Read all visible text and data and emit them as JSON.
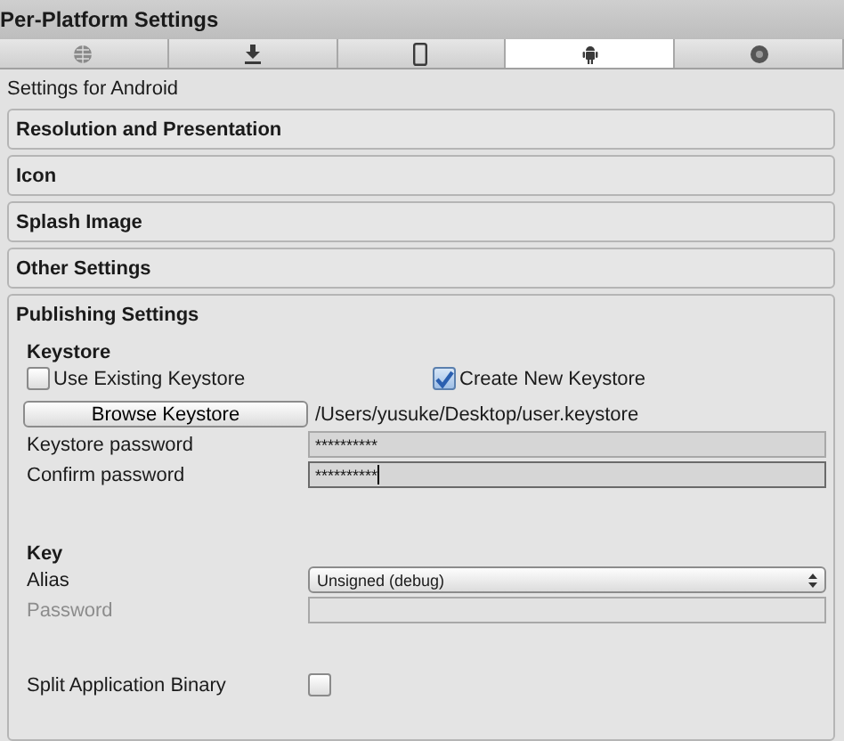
{
  "panel": {
    "title": "Per-Platform Settings"
  },
  "tabs": [
    {
      "kind": "globe",
      "selected": false
    },
    {
      "kind": "download",
      "selected": false
    },
    {
      "kind": "phone",
      "selected": false
    },
    {
      "kind": "android",
      "selected": true
    },
    {
      "kind": "disc",
      "selected": false
    }
  ],
  "subtitle": "Settings for Android",
  "sections": [
    {
      "title": "Resolution and Presentation",
      "expanded": false
    },
    {
      "title": "Icon",
      "expanded": false
    },
    {
      "title": "Splash Image",
      "expanded": false
    },
    {
      "title": "Other Settings",
      "expanded": false
    }
  ],
  "publishing": {
    "title": "Publishing Settings",
    "keystore": {
      "heading": "Keystore",
      "options": [
        {
          "label": "Use Existing Keystore",
          "checked": false
        },
        {
          "label": "Create New Keystore",
          "checked": true
        }
      ],
      "browse_button": "Browse Keystore",
      "path": "/Users/yusuke/Desktop/user.keystore",
      "fields": [
        {
          "label": "Keystore password",
          "value": "**********",
          "focused": false
        },
        {
          "label": "Confirm password",
          "value": "**********",
          "focused": true
        }
      ]
    },
    "key": {
      "heading": "Key",
      "alias": {
        "label": "Alias",
        "value": "Unsigned (debug)"
      },
      "password": {
        "label": "Password",
        "disabled": true
      }
    },
    "split_binary": {
      "label": "Split Application Binary",
      "checked": false
    }
  }
}
